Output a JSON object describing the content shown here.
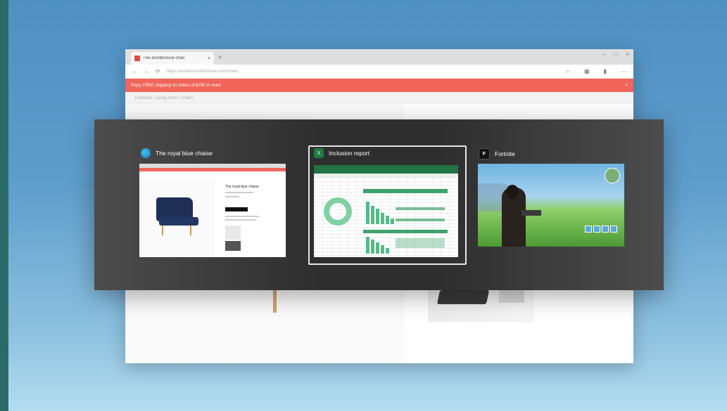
{
  "browser": {
    "tab_label": "The architectural chair",
    "tab_close": "×",
    "new_tab": "+",
    "window_controls": [
      "–",
      "□",
      "×"
    ],
    "nav": [
      "←",
      "→",
      "⟳"
    ],
    "address": "https://architecturefurniture.com/chairs",
    "banner_text": "Enjoy FREE shipping on orders of $150 or more",
    "banner_close": "×",
    "breadcrumbs": "Furniture  /  Living room  /  Chairs"
  },
  "switcher": {
    "windows": [
      {
        "title": "The royal blue chaise",
        "app_icon": "edge-icon",
        "page_title": "The royal blue chaise"
      },
      {
        "title": "Inclusion report",
        "app_icon": "excel-icon",
        "selected": true
      },
      {
        "title": "Fortnite",
        "app_icon": "fortnite-icon",
        "icon_letter": "F"
      }
    ]
  },
  "colors": {
    "banner": "#f1655a",
    "excel": "#217346",
    "edge": "#1477c9"
  }
}
